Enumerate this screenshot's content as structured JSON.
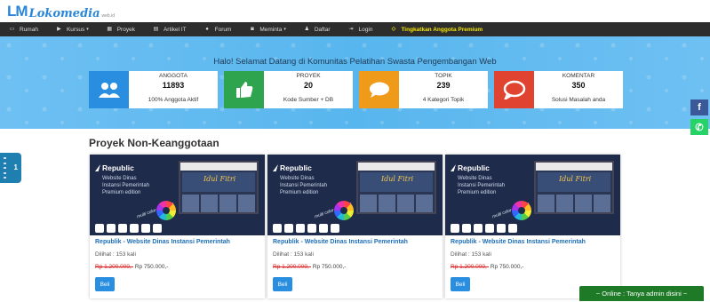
{
  "brand": {
    "mark": "LM",
    "name": "Lokomedia",
    "sub": "web.id"
  },
  "nav": [
    {
      "label": "Rumah",
      "icon": "desktop-icon",
      "glyph": "▭",
      "caret": false
    },
    {
      "label": "Kursus",
      "icon": "play-icon",
      "glyph": "▶",
      "caret": true
    },
    {
      "label": "Proyek",
      "icon": "grid-icon",
      "glyph": "▦",
      "caret": false
    },
    {
      "label": "Artikel IT",
      "icon": "document-icon",
      "glyph": "▤",
      "caret": false
    },
    {
      "label": "Forum",
      "icon": "users-icon",
      "glyph": "●",
      "caret": false
    },
    {
      "label": "Meminta",
      "icon": "camera-icon",
      "glyph": "◙",
      "caret": true
    },
    {
      "label": "Daftar",
      "icon": "user-icon",
      "glyph": "♟",
      "caret": false
    },
    {
      "label": "Login",
      "icon": "login-icon",
      "glyph": "⇥",
      "caret": false
    },
    {
      "label": "Tingkatkan Anggota Premium",
      "icon": "diamond-icon",
      "glyph": "◇",
      "caret": false,
      "premium": true
    }
  ],
  "hero": {
    "title": "Halo! Selamat Datang di Komunitas Pelatihan Swasta Pengembangan Web"
  },
  "stats": [
    {
      "label": "ANGGOTA",
      "value": "11893",
      "desc": "100% Anggota Aktif",
      "color": "#2a8ee0",
      "icon": "users-icon"
    },
    {
      "label": "PROYEK",
      "value": "20",
      "desc": "Kode Sumber + DB",
      "color": "#2ea44f",
      "icon": "thumbs-up-icon"
    },
    {
      "label": "TOPIK",
      "value": "239",
      "desc": "4 Kategori Topik",
      "color": "#f09a1a",
      "icon": "chat-icon"
    },
    {
      "label": "KOMENTAR",
      "value": "350",
      "desc": "Solusi Masalah anda",
      "color": "#e0432f",
      "icon": "comment-icon"
    }
  ],
  "side_tab": {
    "label": "1"
  },
  "social": {
    "facebook": "f",
    "whatsapp": "✆"
  },
  "section": {
    "title": "Proyek Non-Keanggotaan"
  },
  "thumb": {
    "brand": "Republic",
    "lines": [
      "Website Dinas",
      "Instansi Pemerintah",
      "Premium edition"
    ],
    "banner": "Idul Fitri",
    "multicolor": "multi color selection"
  },
  "cards": [
    {
      "title": "Republik - Website Dinas Instansi Pemerintah",
      "seen_label": "Dilihat :",
      "seen": "153 kali",
      "old_price": "Rp 1.200.000,-",
      "price": "Rp 750.000,-",
      "button": "Beli"
    },
    {
      "title": "Republik - Website Dinas Instansi Pemerintah",
      "seen_label": "Dilihat :",
      "seen": "153 kali",
      "old_price": "Rp 1.200.000,-",
      "price": "Rp 750.000,-",
      "button": "Beli"
    },
    {
      "title": "Republik - Website Dinas Instansi Pemerintah",
      "seen_label": "Dilihat :",
      "seen": "153 kali",
      "old_price": "Rp 1.200.000,-",
      "price": "Rp 750.000,-",
      "button": "Beli"
    }
  ],
  "online": {
    "label": "~ Online : Tanya admin disini ~"
  }
}
